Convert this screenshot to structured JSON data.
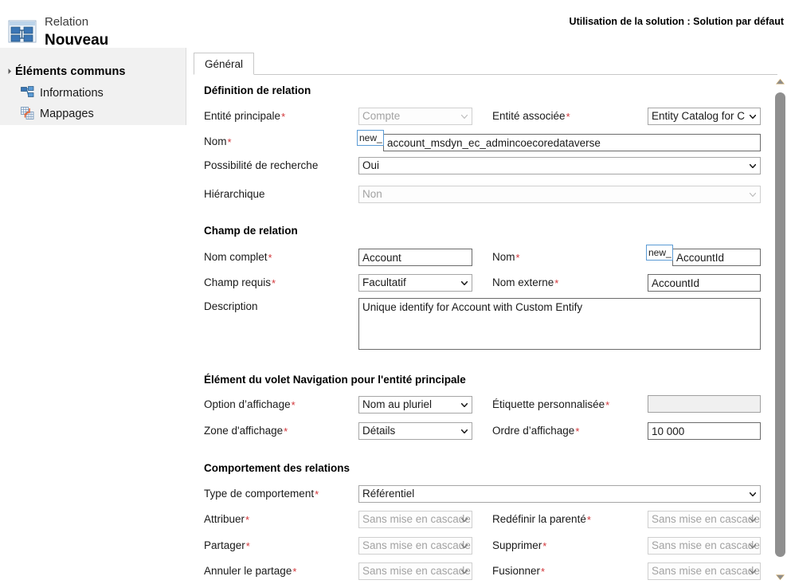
{
  "header": {
    "kind": "Relation",
    "name": "Nouveau",
    "solution_usage": "Utilisation de la solution : Solution par défaut",
    "entity_icon": "relationship-icon"
  },
  "sidebar": {
    "group_label": "Éléments communs",
    "items": [
      {
        "label": "Informations",
        "icon": "information-relationship-icon"
      },
      {
        "label": "Mappages",
        "icon": "mappings-icon"
      }
    ]
  },
  "tabs": [
    {
      "label": "Général",
      "selected": true
    }
  ],
  "form": {
    "sections": [
      {
        "title": "Définition de relation",
        "fields": {
          "entite_principale_label": "Entité principale",
          "entite_principale_value": "Compte",
          "entite_associee_label": "Entité associée",
          "entite_associee_value": "Entity Catalog for C",
          "nom_label": "Nom",
          "nom_prefix": "new_",
          "nom_value": "account_msdyn_ec_admincoecoredataverse",
          "recherche_label": "Possibilité de recherche",
          "recherche_value": "Oui",
          "hierarchique_label": "Hiérarchique",
          "hierarchique_value": "Non"
        }
      },
      {
        "title": "Champ de relation",
        "fields": {
          "nom_complet_label": "Nom complet",
          "nom_complet_value": "Account",
          "nom_label": "Nom",
          "nom_prefix": "new_",
          "nom_value": "AccountId",
          "champ_requis_label": "Champ requis",
          "champ_requis_value": "Facultatif",
          "nom_externe_label": "Nom externe",
          "nom_externe_value": "AccountId",
          "description_label": "Description",
          "description_value": "Unique identify for Account with Custom Entify"
        }
      },
      {
        "title": "Élément du volet Navigation pour l'entité principale",
        "fields": {
          "option_affichage_label": "Option d’affichage",
          "option_affichage_value": "Nom au pluriel",
          "etiquette_label": "Étiquette personnalisée",
          "etiquette_value": "",
          "zone_affichage_label": "Zone d'affichage",
          "zone_affichage_value": "Détails",
          "ordre_affichage_label": "Ordre d’affichage",
          "ordre_affichage_value": "10 000"
        }
      },
      {
        "title": "Comportement des relations",
        "fields": {
          "type_comportement_label": "Type de comportement",
          "type_comportement_value": "Référentiel",
          "attribuer_label": "Attribuer",
          "attribuer_value": "Sans mise en cascade",
          "redefinir_label": "Redéfinir la parenté",
          "redefinir_value": "Sans mise en cascade",
          "partager_label": "Partager",
          "partager_value": "Sans mise en cascade",
          "supprimer_label": "Supprimer",
          "supprimer_value": "Sans mise en cascade",
          "annuler_partage_label": "Annuler le partage",
          "annuler_partage_value": "Sans mise en cascade",
          "fusionner_label": "Fusionner",
          "fusionner_value": "Sans mise en cascade"
        }
      }
    ]
  },
  "required_marker": "*",
  "scrollbar": {
    "up_icon": "triangle-up-icon",
    "down_icon": "triangle-down-icon"
  },
  "colors": {
    "required_red": "#d13438",
    "sidebar_bg": "#f1f1f1",
    "accent_blue": "#5b9bd5"
  }
}
